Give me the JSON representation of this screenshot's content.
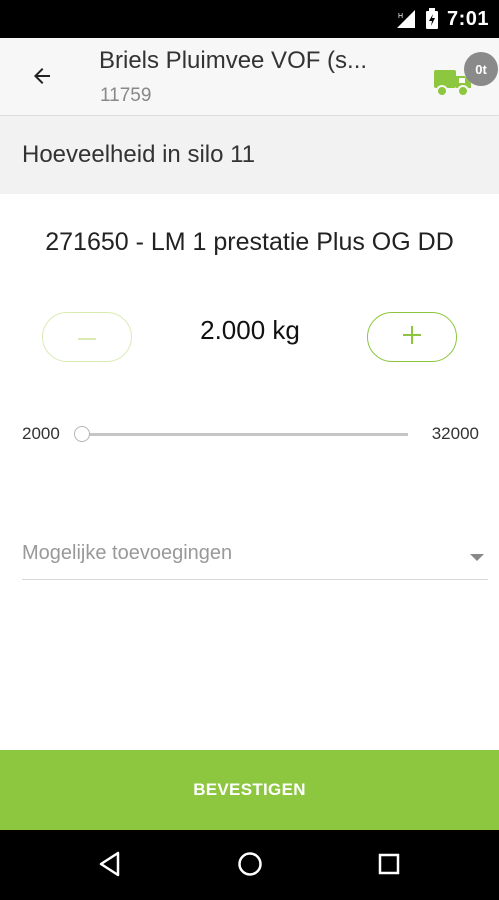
{
  "status_bar": {
    "time": "7:01"
  },
  "app_bar": {
    "title": "Briels Pluimvee VOF (s...",
    "subtitle": "11759",
    "back_icon": "arrow-left-icon",
    "truck_icon": "truck-icon",
    "truck_badge": "0t",
    "truck_color": "#8dc63f"
  },
  "section": {
    "title": "Hoeveelheid in silo 11"
  },
  "product": {
    "name": "271650 - LM 1 prestatie Plus OG DD"
  },
  "quantity": {
    "value": "2.000 kg",
    "minus_icon": "minus-icon",
    "plus_icon": "plus-icon"
  },
  "slider": {
    "min_label": "2000",
    "max_label": "32000",
    "value": 2000,
    "min": 2000,
    "max": 32000
  },
  "additions": {
    "placeholder": "Mogelijke toevoegingen",
    "caret_icon": "caret-down-icon"
  },
  "confirm": {
    "label": "BEVESTIGEN",
    "color": "#8dc63f"
  },
  "nav_bar": {
    "back_icon": "nav-back-icon",
    "home_icon": "nav-home-icon",
    "recents_icon": "nav-recents-icon"
  }
}
